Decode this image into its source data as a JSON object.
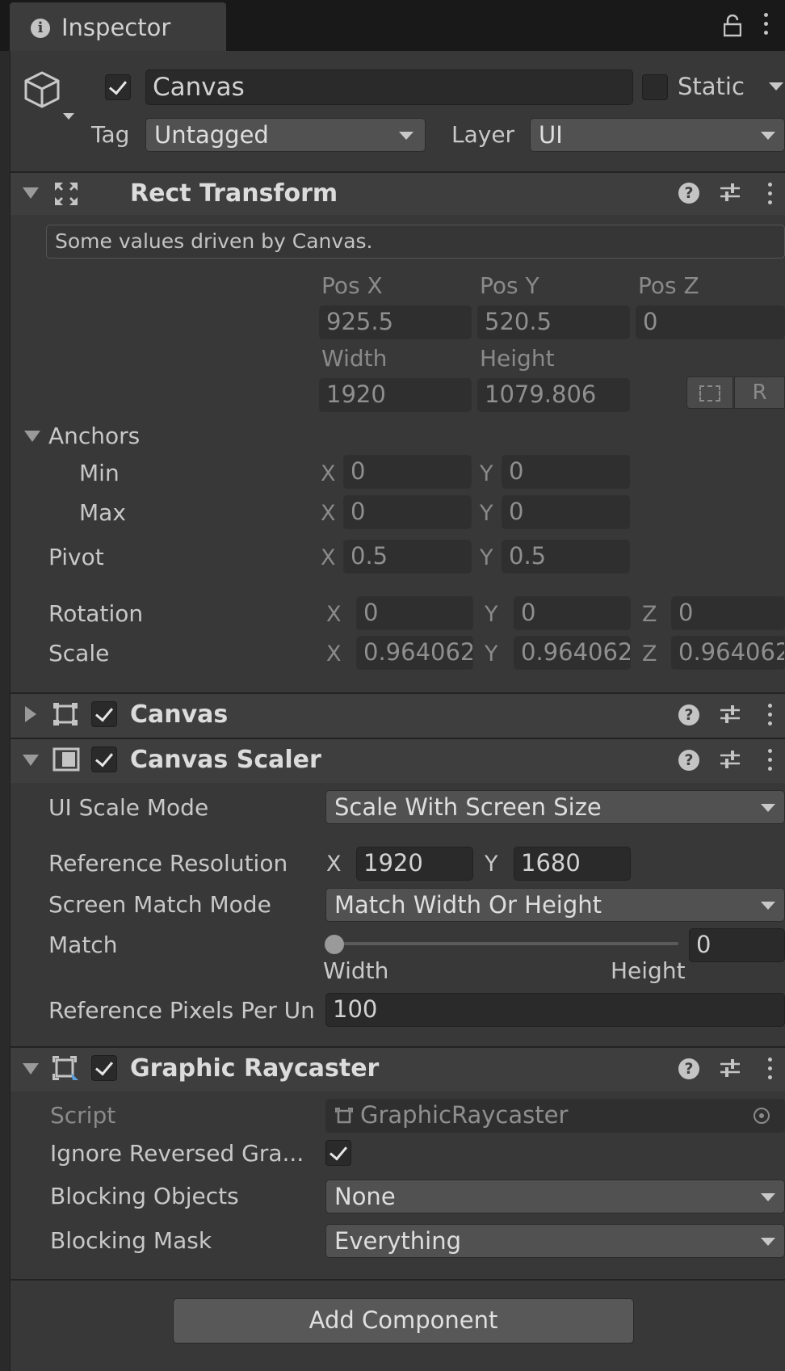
{
  "window": {
    "tab_title": "Inspector",
    "icons": [
      "info-icon",
      "lock-icon",
      "kebab-menu-icon"
    ]
  },
  "object": {
    "active": true,
    "name": "Canvas",
    "static_label": "Static",
    "static": false,
    "tag_label": "Tag",
    "tag_value": "Untagged",
    "layer_label": "Layer",
    "layer_value": "UI"
  },
  "rect_transform": {
    "title": "Rect Transform",
    "driven_notice": "Some values driven by Canvas.",
    "pos_x_label": "Pos X",
    "pos_y_label": "Pos Y",
    "pos_z_label": "Pos Z",
    "pos_x": "925.5",
    "pos_y": "520.5",
    "pos_z": "0",
    "width_label": "Width",
    "height_label": "Height",
    "width": "1920",
    "height": "1079.806",
    "r_button": "R",
    "anchors_label": "Anchors",
    "min_label": "Min",
    "max_label": "Max",
    "min_x": "0",
    "min_y": "0",
    "max_x": "0",
    "max_y": "0",
    "pivot_label": "Pivot",
    "pivot_x": "0.5",
    "pivot_y": "0.5",
    "rotation_label": "Rotation",
    "rot_x": "0",
    "rot_y": "0",
    "rot_z": "0",
    "scale_label": "Scale",
    "scale_x": "0.964062",
    "scale_y": "0.964062",
    "scale_z": "0.964062",
    "axis_x": "X",
    "axis_y": "Y",
    "axis_z": "Z"
  },
  "canvas": {
    "title": "Canvas",
    "enabled": true,
    "expanded": false
  },
  "canvas_scaler": {
    "title": "Canvas Scaler",
    "enabled": true,
    "ui_scale_mode_label": "UI Scale Mode",
    "ui_scale_mode": "Scale With Screen Size",
    "ref_res_label": "Reference Resolution",
    "ref_x": "1920",
    "ref_y": "1680",
    "screen_match_label": "Screen Match Mode",
    "screen_match": "Match Width Or Height",
    "match_label": "Match",
    "match_value": "0",
    "match_min_label": "Width",
    "match_max_label": "Height",
    "ref_ppu_label": "Reference Pixels Per Un",
    "ref_ppu": "100"
  },
  "graphic_raycaster": {
    "title": "Graphic Raycaster",
    "enabled": true,
    "script_label": "Script",
    "script_value": "GraphicRaycaster",
    "ignore_reversed_label": "Ignore Reversed Gra...",
    "ignore_reversed": true,
    "blocking_objects_label": "Blocking Objects",
    "blocking_objects": "None",
    "blocking_mask_label": "Blocking Mask",
    "blocking_mask": "Everything"
  },
  "add_component_label": "Add Component",
  "colors": {
    "background": "#383838",
    "header": "#3e3e3e",
    "field": "#2a2a2a",
    "dropdown": "#515151",
    "text": "#c8c8c8"
  }
}
